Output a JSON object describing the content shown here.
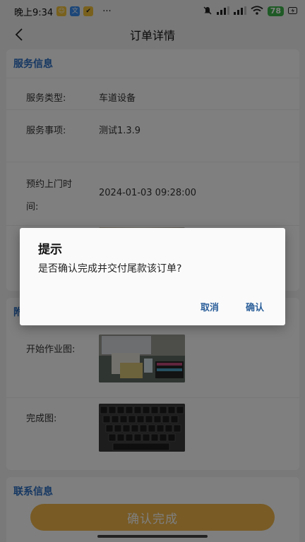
{
  "status_bar": {
    "time": "晚上9:34",
    "more": "···",
    "battery": "78"
  },
  "nav": {
    "title": "订单详情"
  },
  "service_info": {
    "title": "服务信息",
    "rows": [
      {
        "label": "服务类型:",
        "value": "车道设备"
      },
      {
        "label": "服务事项:",
        "value": "测试1.3.9"
      },
      {
        "label_line1": "预约上门时",
        "label_line2": "间:",
        "value": "2024-01-03 09:28:00"
      }
    ]
  },
  "attachments": {
    "title_partial": "附",
    "rows": [
      {
        "label": "开始作业图:"
      },
      {
        "label": "完成图:"
      }
    ]
  },
  "contact_info": {
    "title": "联系信息"
  },
  "bottom_button": {
    "label": "确认完成"
  },
  "dialog": {
    "title": "提示",
    "message": "是否确认完成并交付尾款该订单?",
    "cancel_label": "取消",
    "confirm_label": "确认"
  },
  "colors": {
    "accent": "#2a6fc4",
    "button": "#f1b64a",
    "dialog_action": "#2b5f9a"
  }
}
